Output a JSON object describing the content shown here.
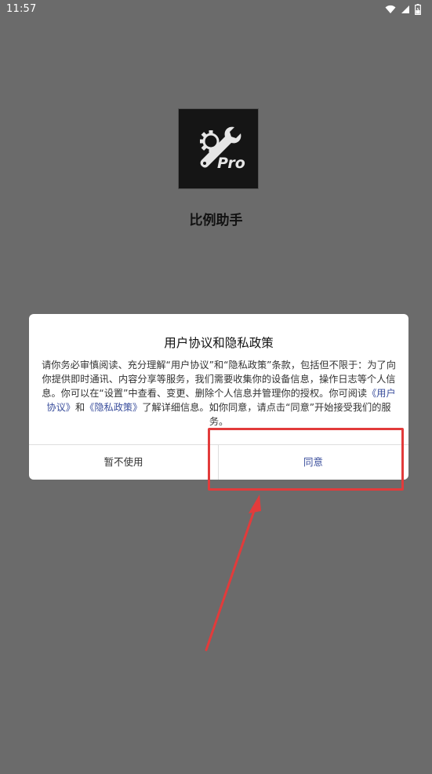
{
  "status_bar": {
    "time": "11:57",
    "icons": [
      "wifi-icon",
      "signal-icon",
      "battery-icon"
    ]
  },
  "app": {
    "name": "比例助手",
    "icon": "wrench-gear-icon",
    "icon_text": "Pro"
  },
  "dialog": {
    "title": "用户协议和隐私政策",
    "body_line1": "请你务必审慎阅读、充分理解“用户协议”和“隐私政策”条款，包括但不限于：为了向你提供即时通讯、内容分享等服务，我们需要收集你的设备信息，操作日志等个人信息。你可以在“设置”中查看、变更、删除个人信息并管理你的授权。你可阅读",
    "link_user_agreement": "《用户协议》",
    "and_text": "和",
    "link_privacy_policy": "《隐私政策》",
    "body_line2": "了解详细信息。如你同意，请点击“同意”开始接受我们的服务。",
    "cancel_label": "暂不使用",
    "agree_label": "同意"
  },
  "colors": {
    "overlay_background": "#6b6b6b",
    "link": "#3a4e9c",
    "annotation": "#e23b3b"
  }
}
